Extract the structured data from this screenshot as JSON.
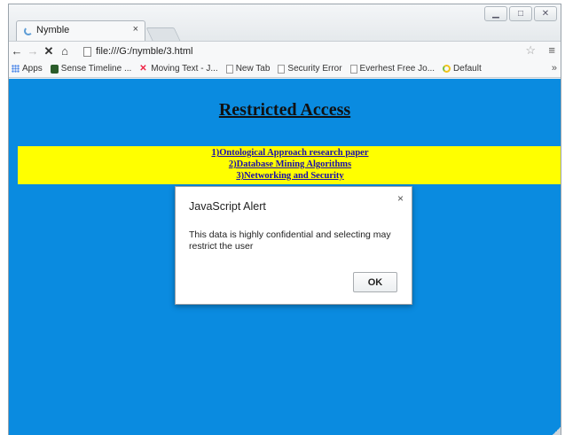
{
  "browser": {
    "tab_title": "Nymble",
    "tab_close": "×",
    "url": "file:///G:/nymble/3.html",
    "window_controls": [
      "minimize",
      "maximize",
      "close"
    ]
  },
  "toolbar": {
    "back_icon": "←",
    "forward_icon": "→",
    "stop_icon": "✕",
    "home_icon": "⌂",
    "star_icon": "☆",
    "menu_icon": "≡"
  },
  "bookmarks": [
    {
      "label": "Apps",
      "icon": "apps-icon"
    },
    {
      "label": "Sense Timeline ...",
      "icon": "sense-icon"
    },
    {
      "label": "Moving Text - J...",
      "icon": "moving-text-icon"
    },
    {
      "label": "New Tab",
      "icon": "page-icon"
    },
    {
      "label": "Security Error",
      "icon": "page-icon"
    },
    {
      "label": "Everhest Free Jo...",
      "icon": "page-icon"
    },
    {
      "label": "Default",
      "icon": "default-icon"
    }
  ],
  "bookmarks_more": "»",
  "page": {
    "heading": "Restricted Access",
    "background": "#0a8be0",
    "highlight": "#ffff00",
    "links": [
      "1)Ontological Approach research paper",
      "2)Database Mining Algorithms",
      "3)Networking and Security"
    ]
  },
  "alert": {
    "title": "JavaScript Alert",
    "close": "×",
    "message": "This data is highly confidential and selecting may restrict the user",
    "ok_label": "OK"
  }
}
